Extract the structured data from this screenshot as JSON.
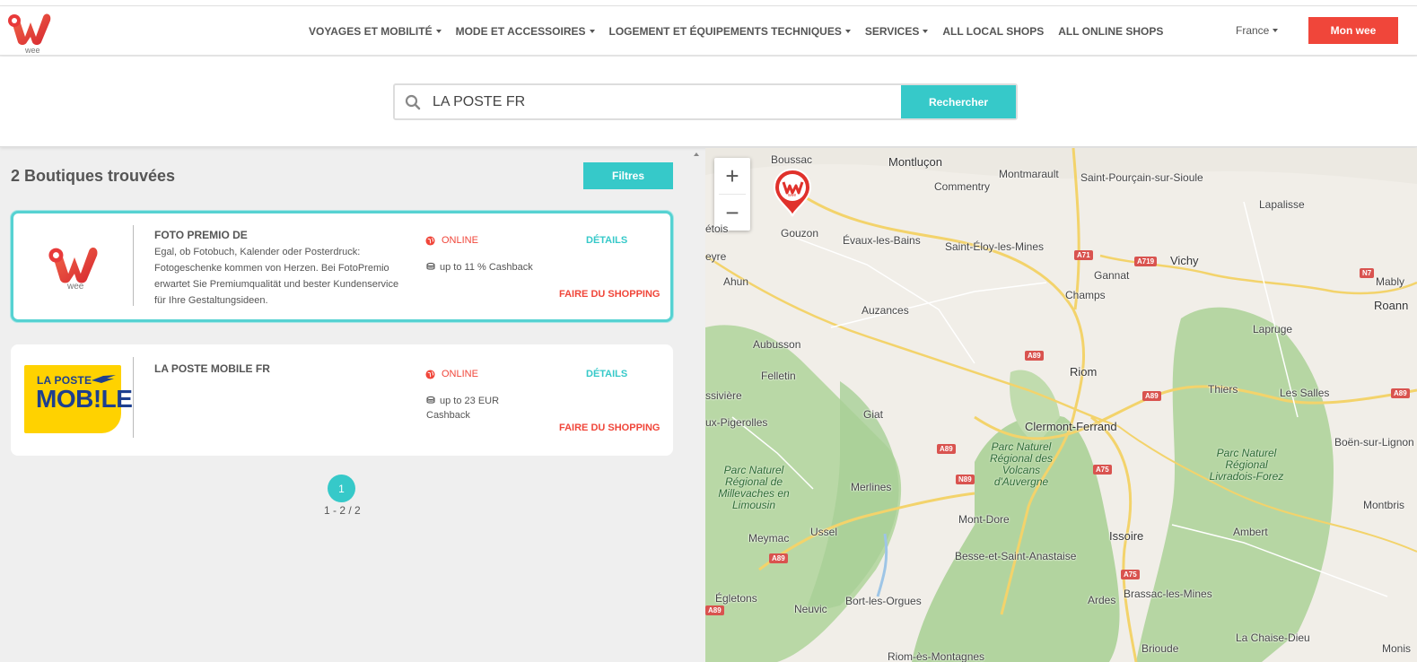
{
  "header": {
    "logo_text": "wee",
    "nav": [
      {
        "label": "VOYAGES ET MOBILITÉ",
        "dropdown": true
      },
      {
        "label": "MODE ET ACCESSOIRES",
        "dropdown": true
      },
      {
        "label": "LOGEMENT ET ÉQUIPEMENTS TECHNIQUES",
        "dropdown": true
      },
      {
        "label": "SERVICES",
        "dropdown": true
      },
      {
        "label": "ALL LOCAL SHOPS",
        "dropdown": false
      },
      {
        "label": "ALL ONLINE SHOPS",
        "dropdown": false
      }
    ],
    "country": "France",
    "account_button": "Mon wee"
  },
  "search": {
    "value": "LA POSTE FR",
    "button": "Rechercher"
  },
  "results": {
    "title": "2 Boutiques trouvées",
    "filters_button": "Filtres",
    "shops": [
      {
        "name": "FOTO PREMIO DE",
        "description": "Egal, ob Fotobuch, Kalender oder Posterdruck: Fotogeschenke kommen von Herzen. Bei FotoPremio erwartet Sie Premiumqualität und bester Kundenservice für Ihre Gestaltungsideen.",
        "status": "ONLINE",
        "cashback": "up to 11 % Cashback",
        "details": "DÉTAILS",
        "shop": "FAIRE DU SHOPPING",
        "logo": "wee-logo",
        "logo_text": "wee",
        "selected": true
      },
      {
        "name": "LA POSTE MOBILE FR",
        "description": "",
        "status": "ONLINE",
        "cashback": "up to 23 EUR Cashback",
        "details": "DÉTAILS",
        "shop": "FAIRE DU SHOPPING",
        "logo": "la-poste-mobile-logo",
        "logo_line1": "LA POSTE",
        "logo_line2": "MOB!LE",
        "selected": false
      }
    ],
    "pagination": {
      "current_page": "1",
      "range": "1 - 2 / 2"
    }
  },
  "map": {
    "zoom_in": "+",
    "zoom_out": "−",
    "marker_text": "wee",
    "cities": [
      "Boussac",
      "Montluçon",
      "Montmarault",
      "Saint-Pourçain-sur-Sioule",
      "Commentry",
      "Lapalisse",
      "étois",
      "Gouzon",
      "Évaux-les-Bains",
      "Saint-Éloy-les-Mines",
      "Gannat",
      "Vichy",
      "eyre",
      "Ahun",
      "Champs",
      "Mably",
      "Roann",
      "Auzances",
      "Lapruge",
      "Aubusson",
      "Riom",
      "Felletin",
      "ssivière",
      "Thiers",
      "Les Salles",
      "Giat",
      "Clermont-Ferrand",
      "ux-Pigerolles",
      "Boën-sur-Lignon",
      "Merlines",
      "Mont-Dore",
      "Issoire",
      "Ambert",
      "Montbris",
      "Meymac",
      "Ussel",
      "Besse-et-Saint-Anastaise",
      "Égletons",
      "Bort-les-Orgues",
      "Ardes",
      "Brassac-les-Mines",
      "Neuvic",
      "Brioude",
      "La Chaise-Dieu",
      "Monis",
      "Riom-ès-Montagnes"
    ],
    "parks": [
      "Parc Naturel Régional de Millevaches en Limousin",
      "Parc Naturel Régional des Volcans d'Auvergne",
      "Parc Naturel Régional Livradois-Forez"
    ],
    "roads": [
      "A71",
      "A719",
      "N7",
      "A89",
      "A89",
      "A89",
      "A75",
      "N89",
      "A89",
      "A75",
      "A89",
      "A89"
    ]
  },
  "colors": {
    "accent": "#36c9c9",
    "brand": "#f0463a"
  }
}
